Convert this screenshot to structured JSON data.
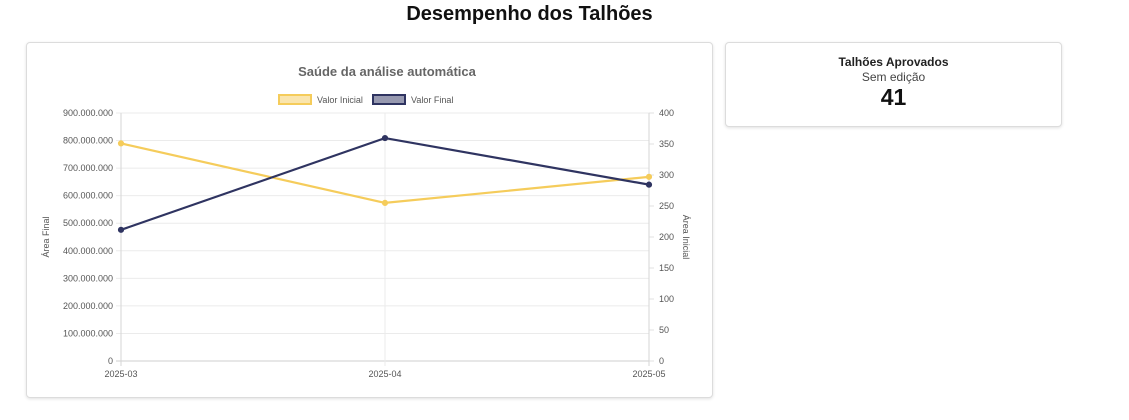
{
  "page": {
    "title": "Desempenho dos Talhões"
  },
  "stat_card": {
    "title": "Talhões Aprovados",
    "subtitle": "Sem edição",
    "value": "41"
  },
  "colors": {
    "initial": "#f5cc5b",
    "final": "#2f3461"
  },
  "chart_data": {
    "type": "line",
    "title": "Saúde da análise automática",
    "categories": [
      "2025-03",
      "2025-04",
      "2025-05"
    ],
    "series": [
      {
        "name": "Valor Inicial",
        "axis": "right",
        "values": [
          351,
          255,
          297
        ]
      },
      {
        "name": "Valor Final",
        "axis": "left",
        "values": [
          476000000,
          809000000,
          640000000
        ]
      }
    ],
    "left_axis": {
      "label": "Área Final",
      "ylim": [
        0,
        900000000
      ],
      "ticks": [
        "0",
        "100.000.000",
        "200.000.000",
        "300.000.000",
        "400.000.000",
        "500.000.000",
        "600.000.000",
        "700.000.000",
        "800.000.000",
        "900.000.000"
      ]
    },
    "right_axis": {
      "label": "Área Inicial",
      "ylim": [
        0,
        400
      ],
      "ticks": [
        "0",
        "50",
        "100",
        "150",
        "200",
        "250",
        "300",
        "350",
        "400"
      ]
    },
    "legend": "top-center",
    "grid": true
  }
}
